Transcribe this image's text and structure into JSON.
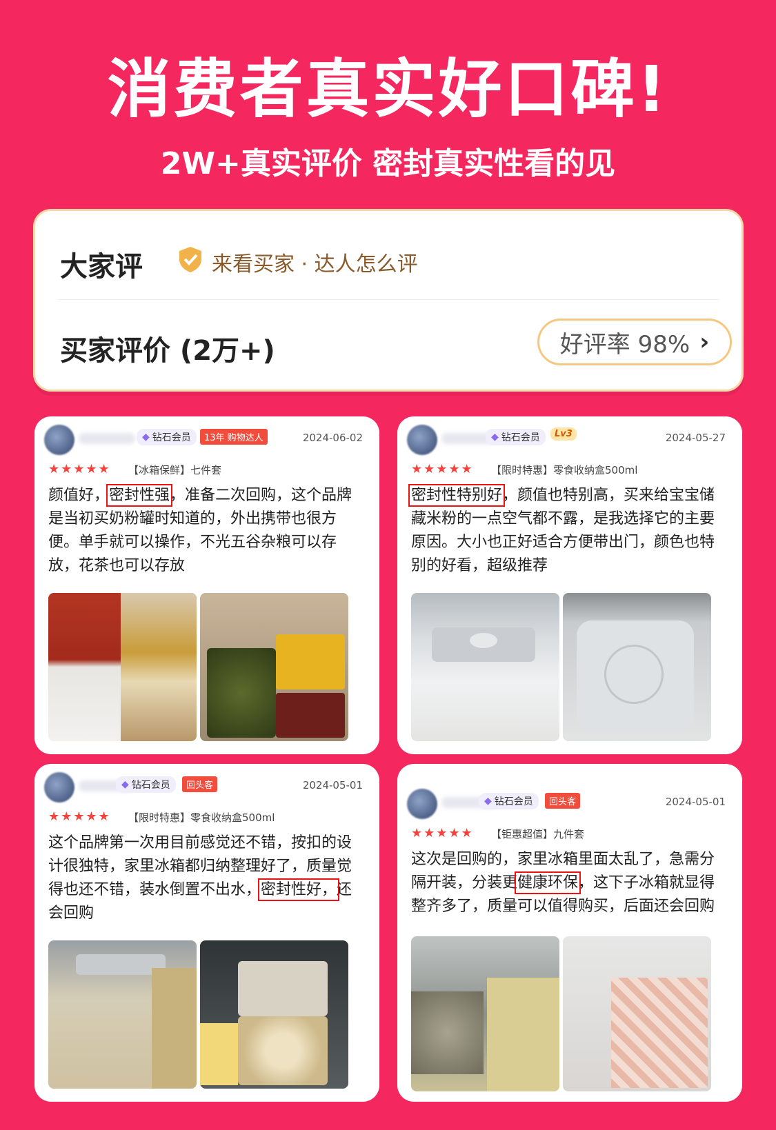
{
  "hero": {
    "title": "消费者真实好口碑!",
    "subtitle": "2W+真实评价 密封真实性看的见"
  },
  "summary": {
    "title": "大家评",
    "tag": "来看买家 · 达人怎么评",
    "count": "买家评价 (2万+)",
    "rate": "好评率 98%"
  },
  "reviews": [
    {
      "member": "钻石会员",
      "badge": "13年 购物达人",
      "date": "2024-06-02",
      "stars": "★★★★★",
      "product": "【冰箱保鲜】七件套",
      "t1": "颜值好，",
      "hl": "密封性强",
      "t2": "，准备二次回购，这个品牌是当初买奶粉罐时知道的，外出携带也很方便。单手就可以操作，不光五谷杂粮可以存放，花茶也可以存放"
    },
    {
      "member": "钻石会员",
      "badge": "Lv3",
      "date": "2024-05-27",
      "stars": "★★★★★",
      "product": "【限时特惠】零食收纳盒500ml",
      "t1": "",
      "hl": "密封性特别好",
      "t2": "，颜值也特别高，买来给宝宝储藏米粉的一点空气都不露，是我选择它的主要原因。大小也正好适合方便带出门，颜色也特别的好看，超级推荐"
    },
    {
      "member": "钻石会员",
      "badge": "回头客",
      "date": "2024-05-01",
      "stars": "★★★★★",
      "product": "【限时特惠】零食收纳盒500ml",
      "t1": "这个品牌第一次用目前感觉还不错，按扣的设计很独特，家里冰箱都归纳整理好了，质量觉得也还不错，装水倒置不出水，",
      "hl": "密封性好，",
      "t2": "还会回购"
    },
    {
      "member": "钻石会员",
      "badge": "回头客",
      "date": "2024-05-01",
      "stars": "★★★★★",
      "product": "【钜惠超值】九件套",
      "t1": "这次是回购的，家里冰箱里面太乱了，急需分隔开装，分装更",
      "hl": "健康环保",
      "t2": "，这下子冰箱就显得整齐多了，质量可以值得购买，后面还会回购"
    }
  ],
  "colors": {
    "background": "#f5275f",
    "star": "#f4423c",
    "highlight": "#e11111"
  }
}
